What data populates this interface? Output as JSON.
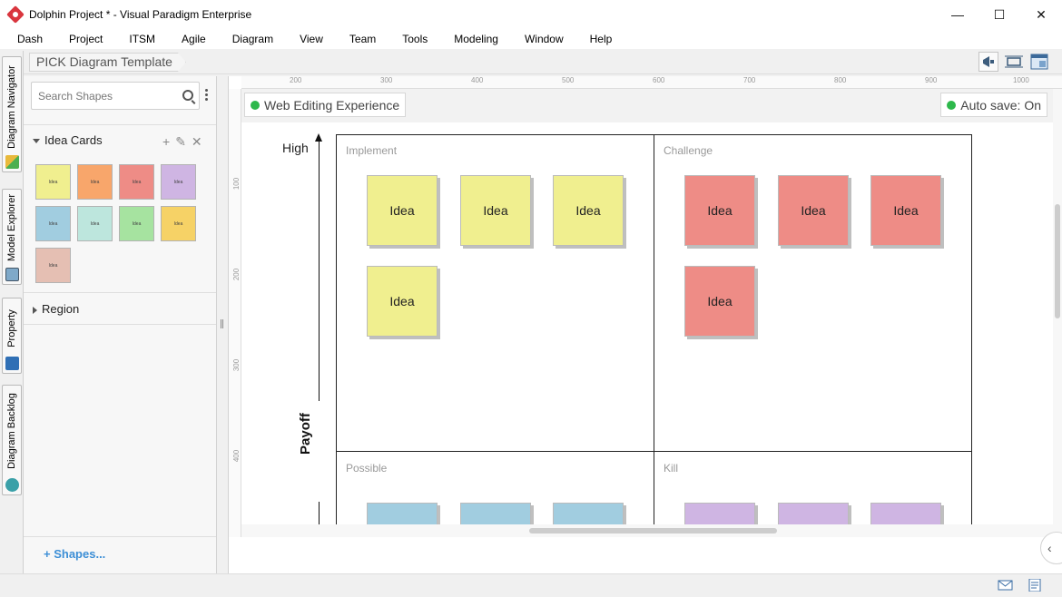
{
  "window": {
    "title": "Dolphin Project * - Visual Paradigm Enterprise",
    "controls": {
      "minimize": "—",
      "maximize": "☐",
      "close": "✕"
    }
  },
  "menu": [
    "Dash",
    "Project",
    "ITSM",
    "Agile",
    "Diagram",
    "View",
    "Team",
    "Tools",
    "Modeling",
    "Window",
    "Help"
  ],
  "breadcrumb": "PICK Diagram Template",
  "vtabs": [
    "Diagram Navigator",
    "Model Explorer",
    "Property",
    "Diagram Backlog"
  ],
  "search": {
    "placeholder": "Search Shapes"
  },
  "sections": {
    "idea_cards": "Idea Cards",
    "region": "Region"
  },
  "palette": {
    "label": "Idea",
    "colors": [
      "#f0ef8f",
      "#f8a66b",
      "#ee8c86",
      "#cfb5e3",
      "#a1cde0",
      "#bde6dd",
      "#a6e3a0",
      "#f6d266",
      "#e5bfb3"
    ]
  },
  "shapes_link": "Shapes...",
  "status_pills": {
    "left": "Web Editing Experience",
    "right": "Auto save: On"
  },
  "ruler": {
    "top": [
      "200",
      "300",
      "400",
      "500",
      "600",
      "700",
      "800",
      "900",
      "1000"
    ],
    "left": [
      "100",
      "200",
      "300",
      "400"
    ]
  },
  "diagram": {
    "axis_high": "High",
    "axis_payoff": "Payoff",
    "quadrants": {
      "q1": "Implement",
      "q2": "Challenge",
      "q3": "Possible",
      "q4": "Kill"
    },
    "card_label": "Idea",
    "colors": {
      "yellow": "#f0ef8f",
      "red": "#ee8c86",
      "blue": "#a1cde0",
      "purple": "#cfb5e3"
    }
  }
}
